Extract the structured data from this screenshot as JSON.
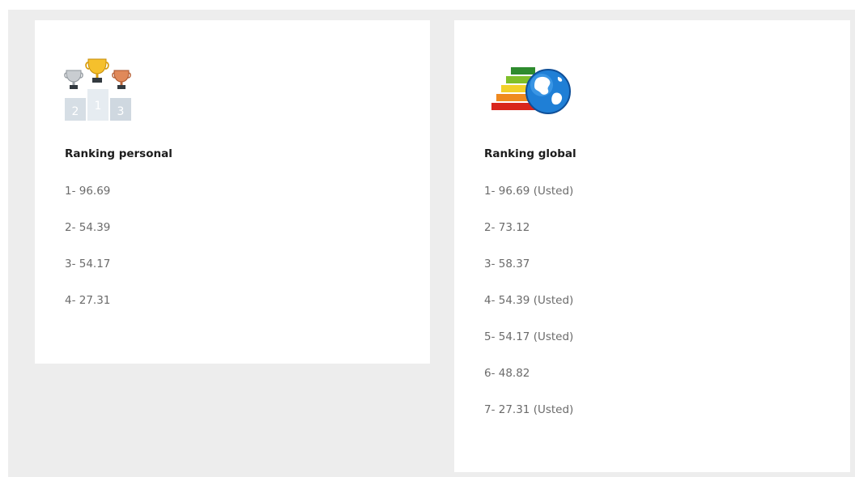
{
  "personal": {
    "icon": "trophy-podium-icon",
    "title": "Ranking personal",
    "items": [
      {
        "label": "1- 96.69"
      },
      {
        "label": "2- 54.39"
      },
      {
        "label": "3- 54.17"
      },
      {
        "label": "4- 27.31"
      }
    ]
  },
  "global": {
    "icon": "globe-energy-bars-icon",
    "title": "Ranking global",
    "items": [
      {
        "label": "1- 96.69 (Usted)"
      },
      {
        "label": "2- 73.12"
      },
      {
        "label": "3- 58.37"
      },
      {
        "label": "4- 54.39 (Usted)"
      },
      {
        "label": "5- 54.17 (Usted)"
      },
      {
        "label": "6- 48.82"
      },
      {
        "label": "7- 27.31 (Usted)"
      }
    ]
  },
  "colors": {
    "background": "#ededed",
    "card": "#ffffff",
    "title": "#1c1c1c",
    "text": "#6b6b6b"
  }
}
